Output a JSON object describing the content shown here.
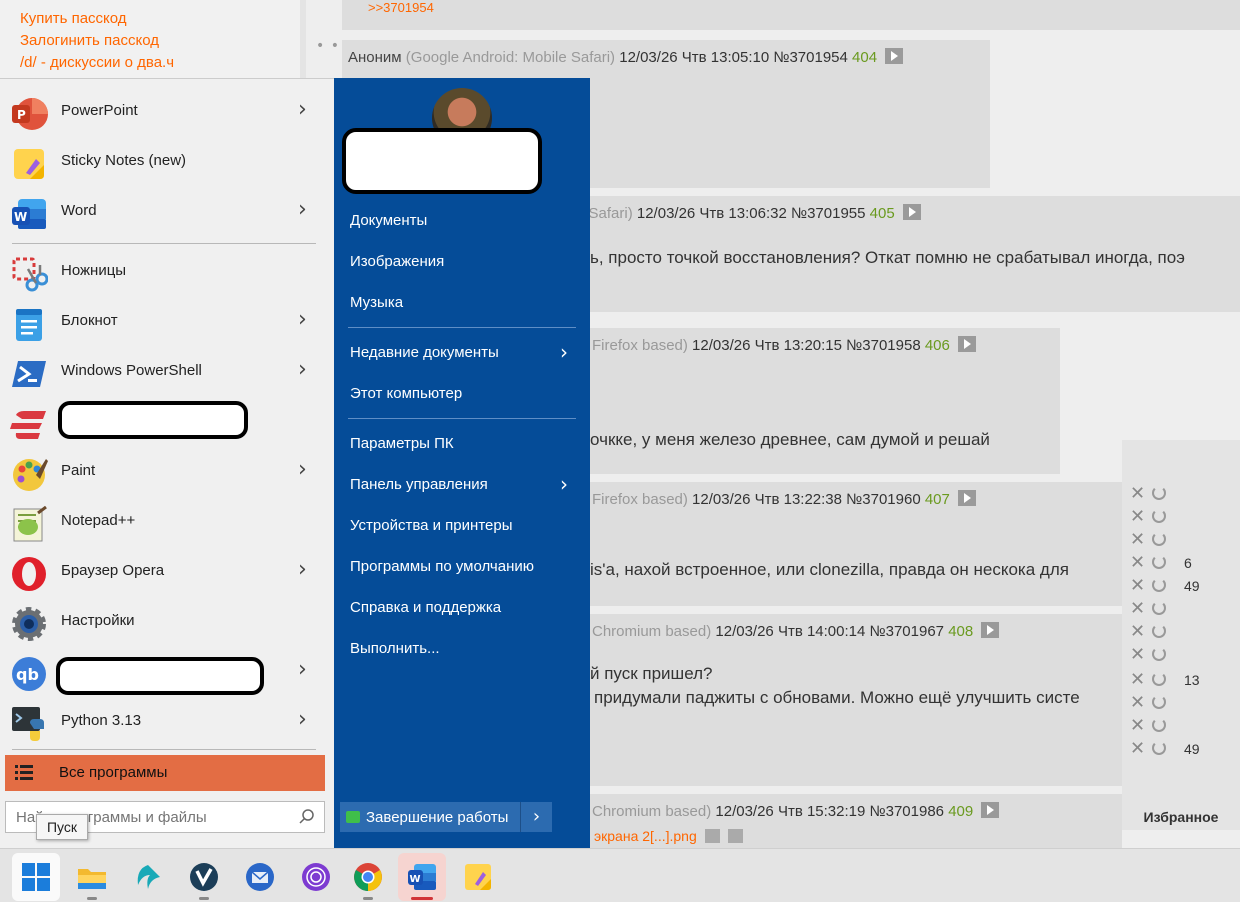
{
  "forum": {
    "links": [
      "Купить пасскод",
      "Залогинить пасскод",
      "/d/ - дискуссии о два.ч"
    ],
    "top_reply": ">>3701954",
    "dots": "• • •",
    "posts": [
      {
        "name": "Аноним",
        "agent": "(Google Android: Mobile Safari)",
        "date": "12/03/26 Чтв 13:05:10",
        "num": "№3701954",
        "count": "404",
        "text": ""
      },
      {
        "name": "",
        "agent": "e Safari)",
        "date": "12/03/26 Чтв 13:06:32",
        "num": "№3701955",
        "count": "405",
        "text": "ь, просто точкой восстановления? Откат помню не срабатывал иногда, поэ"
      },
      {
        "name": "",
        "agent": "Firefox based)",
        "date": "12/03/26 Чтв 13:20:15",
        "num": "№3701958",
        "count": "406",
        "text": "очкке, у меня железо древнее, сам думой и решай"
      },
      {
        "name": "",
        "agent": "Firefox based)",
        "date": "12/03/26 Чтв 13:22:38",
        "num": "№3701960",
        "count": "407",
        "text": "is'a, нахой встроенное, или clonezilla, правда он нескока для"
      },
      {
        "name": "",
        "agent": "Chromium based)",
        "date": "12/03/26 Чтв 14:00:14",
        "num": "№3701967",
        "count": "408",
        "text": "й пуск пришел?",
        "text2": "придумали паджиты с обновами. Можно ещё улучшить систе"
      },
      {
        "name": "",
        "agent": "Chromium based)",
        "date": "12/03/26 Чтв 15:32:19",
        "num": "№3701986",
        "count": "409",
        "file": "экрана 2[...].png"
      }
    ],
    "favorites": {
      "title": "Избранное",
      "counts": [
        "",
        "",
        "",
        "6",
        "49",
        "",
        "",
        "",
        "13",
        "",
        "",
        "49"
      ]
    }
  },
  "start_menu": {
    "apps": [
      {
        "label": "PowerPoint",
        "icon": "powerpoint-icon",
        "arrow": true
      },
      {
        "label": "Sticky Notes (new)",
        "icon": "sticky-notes-icon",
        "arrow": false
      },
      {
        "label": "Word",
        "icon": "word-icon",
        "arrow": true
      },
      {
        "label": "Ножницы",
        "icon": "scissors-icon",
        "arrow": false
      },
      {
        "label": "Блокнот",
        "icon": "notepad-icon",
        "arrow": true
      },
      {
        "label": "Windows PowerShell",
        "icon": "powershell-icon",
        "arrow": true
      },
      {
        "label": "",
        "icon": "expressvpn-icon",
        "arrow": false
      },
      {
        "label": "Paint",
        "icon": "paint-icon",
        "arrow": true
      },
      {
        "label": "Notepad++",
        "icon": "notepadpp-icon",
        "arrow": false
      },
      {
        "label": "Браузер Opera",
        "icon": "opera-icon",
        "arrow": true
      },
      {
        "label": "Настройки",
        "icon": "settings-icon",
        "arrow": false
      },
      {
        "label": "",
        "icon": "qbittorrent-icon",
        "arrow": true
      },
      {
        "label": "Python 3.13",
        "icon": "python-icon",
        "arrow": true
      }
    ],
    "all_programs": "Все программы",
    "search_placeholder": "Найти программы и файлы",
    "right_items": [
      {
        "label": "Документы",
        "arrow": false
      },
      {
        "label": "Изображения",
        "arrow": false
      },
      {
        "label": "Музыка",
        "arrow": false
      },
      {
        "label": "Недавние документы",
        "arrow": true
      },
      {
        "label": "Этот компьютер",
        "arrow": false
      },
      {
        "label": "Параметры ПК",
        "arrow": false
      },
      {
        "label": "Панель управления",
        "arrow": true
      },
      {
        "label": "Устройства и принтеры",
        "arrow": false
      },
      {
        "label": "Программы по умолчанию",
        "arrow": false
      },
      {
        "label": "Справка и поддержка",
        "arrow": false
      },
      {
        "label": "Выполнить...",
        "arrow": false
      }
    ],
    "shutdown": "Завершение работы",
    "arrow_glyph": "›"
  },
  "tooltip": "Пуск",
  "taskbar": {
    "items": [
      "start-icon",
      "file-explorer-icon",
      "browser-wave-icon",
      "vivaldi-icon",
      "thunderbird-icon",
      "tor-browser-icon",
      "chrome-icon",
      "word-icon",
      "sticky-notes-icon"
    ],
    "active": "word-icon"
  },
  "colors": {
    "accent_orange": "#ff6600",
    "post_number_green": "#6a9a1f",
    "start_blue": "#054c98",
    "all_programs_orange": "#e36d44"
  }
}
